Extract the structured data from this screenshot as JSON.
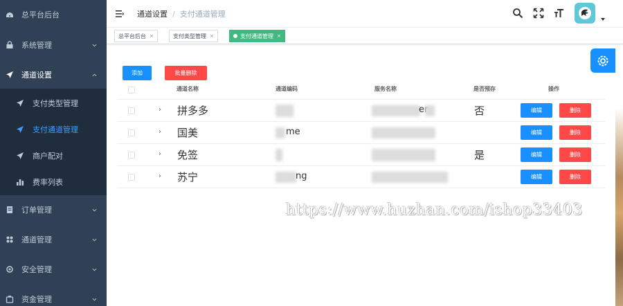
{
  "sidebar": {
    "items": [
      {
        "label": "总平台后台",
        "icon": "dashboard-icon"
      },
      {
        "label": "系统管理",
        "icon": "lock-icon"
      },
      {
        "label": "通道设置",
        "icon": "send-icon"
      },
      {
        "label": "订单管理",
        "icon": "document-icon"
      },
      {
        "label": "通道管理",
        "icon": "grid-icon"
      },
      {
        "label": "安全管理",
        "icon": "gear-icon"
      },
      {
        "label": "资金管理",
        "icon": "wallet-icon"
      }
    ],
    "submenu": [
      {
        "label": "支付类型管理",
        "icon": "send-icon"
      },
      {
        "label": "支付通道管理",
        "icon": "send-icon"
      },
      {
        "label": "商户配对",
        "icon": "send-icon"
      },
      {
        "label": "费率列表",
        "icon": "bar-chart-icon"
      }
    ]
  },
  "header": {
    "breadcrumb": [
      "通道设置",
      "支付通道管理"
    ]
  },
  "tags": [
    {
      "label": "总平台后台",
      "active": false
    },
    {
      "label": "支付类型管理",
      "active": false
    },
    {
      "label": "支付通道管理",
      "active": true
    }
  ],
  "toolbar": {
    "add_label": "添加",
    "batch_delete_label": "批量删除"
  },
  "table": {
    "columns": [
      "通道名称",
      "通道编码",
      "服务名称",
      "是否预存",
      "操作"
    ],
    "rows": [
      {
        "name": "拼多多",
        "code_visible": "",
        "service_visible": "er",
        "prestore": "否"
      },
      {
        "name": "国美",
        "code_visible": "me",
        "service_visible": "",
        "prestore": ""
      },
      {
        "name": "免签",
        "code_visible": "",
        "service_visible": "",
        "prestore": "是"
      },
      {
        "name": "苏宁",
        "code_visible": "ng",
        "service_visible": "",
        "prestore": ""
      }
    ],
    "edit_label": "编辑",
    "delete_label": "删除"
  },
  "watermark": "https://www.huzhan.com/ishop33403",
  "colors": {
    "sidebar_bg": "#304156",
    "primary": "#1890ff",
    "danger": "#ff4949",
    "active_tag": "#42b983",
    "active_menu": "#409eff"
  }
}
